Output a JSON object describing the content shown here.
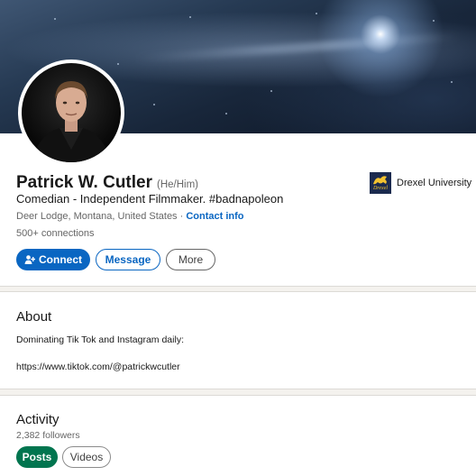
{
  "profile": {
    "name": "Patrick W. Cutler",
    "pronouns": "(He/Him)",
    "headline": "Comedian - Independent Filmmaker. #badnapoleon",
    "location": "Deer Lodge, Montana, United States",
    "separator": " · ",
    "contact_info": "Contact info",
    "connections": "500+ connections",
    "education": {
      "logo_text": "Drexel",
      "name": "Drexel University"
    }
  },
  "actions": {
    "connect": "Connect",
    "message": "Message",
    "more": "More"
  },
  "about": {
    "title": "About",
    "line1": "Dominating Tik Tok and Instagram daily:",
    "line2": "https://www.tiktok.com/@patrickwcutler"
  },
  "activity": {
    "title": "Activity",
    "followers": "2,382 followers",
    "tabs": [
      {
        "label": "Posts",
        "active": true
      },
      {
        "label": "Videos",
        "active": false
      }
    ]
  },
  "colors": {
    "primary": "#0a66c2",
    "active_pill": "#01754f"
  }
}
